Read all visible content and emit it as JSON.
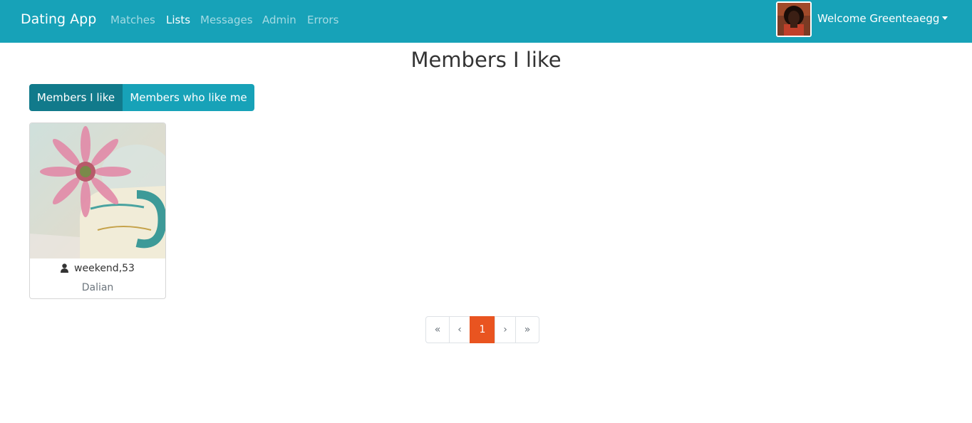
{
  "navbar": {
    "brand": "Dating App",
    "links": [
      {
        "label": "Matches",
        "active": false
      },
      {
        "label": "Lists",
        "active": true
      },
      {
        "label": "Messages",
        "active": false
      },
      {
        "label": "Admin",
        "active": false
      },
      {
        "label": "Errors",
        "active": false
      }
    ],
    "welcome": "Welcome Greenteaegg"
  },
  "page": {
    "title": "Members I like"
  },
  "filter_buttons": {
    "liked": "Members I like",
    "likers": "Members who like me"
  },
  "members": [
    {
      "name_age": "weekend,53",
      "city": "Dalian"
    }
  ],
  "pagination": {
    "first": "«",
    "prev": "‹",
    "current": "1",
    "next": "›",
    "last": "»"
  },
  "colors": {
    "navbar": "#17a2b8",
    "active_button": "#117a8b",
    "button": "#17a2b8",
    "current_page": "#e95420"
  }
}
